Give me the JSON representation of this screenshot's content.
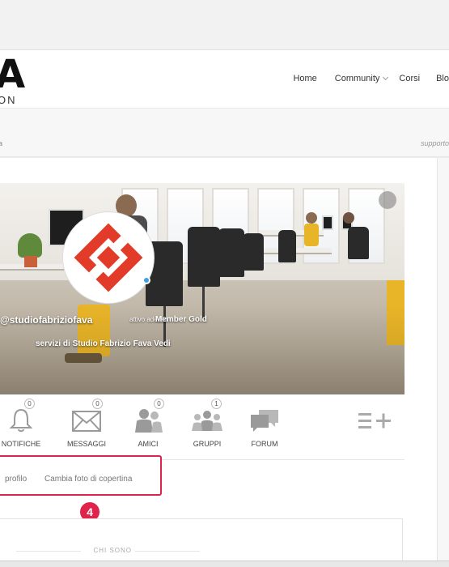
{
  "header": {
    "logo_letter": "A",
    "logo_sub": "ON",
    "nav": [
      {
        "label": "Home"
      },
      {
        "label": "Community"
      },
      {
        "label": "Corsi"
      },
      {
        "label": "Blo"
      }
    ]
  },
  "subbar": {
    "left_text": "a",
    "right_text": "supporto"
  },
  "profile": {
    "handle": "@studiofabriziofava",
    "activity": "attivo adesso",
    "membership": "Member Gold",
    "tagline": "servizi di Studio Fabrizio Fava Vedi"
  },
  "profile_nav": [
    {
      "label": "NOTIFICHE",
      "count": "0",
      "icon": "bell-icon"
    },
    {
      "label": "MESSAGGI",
      "count": "0",
      "icon": "envelope-icon"
    },
    {
      "label": "AMICI",
      "count": "0",
      "icon": "friends-icon"
    },
    {
      "label": "GRUPPI",
      "count": "1",
      "icon": "groups-icon"
    },
    {
      "label": "FORUM",
      "count": "",
      "icon": "forum-icon"
    }
  ],
  "profile_links": {
    "profile": "profilo",
    "cover": "Cambia foto di copertina"
  },
  "step_badge": "4",
  "about": {
    "title": "CHI SONO"
  },
  "colors": {
    "accent": "#e0234b",
    "online": "#3ba0e6",
    "logo_red": "#e23b2a"
  }
}
